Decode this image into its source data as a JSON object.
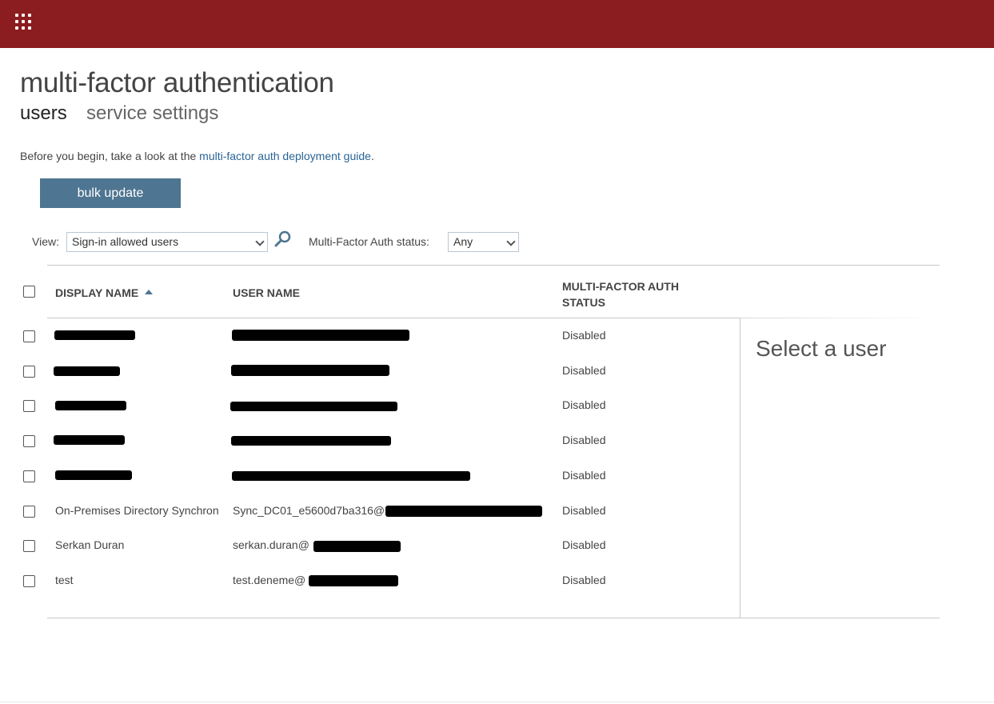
{
  "header": {
    "waffle_icon": "waffle-grid-icon",
    "brand_color": "#8b1c1f"
  },
  "page": {
    "title": "multi-factor authentication",
    "tabs": [
      {
        "label": "users",
        "active": true
      },
      {
        "label": "service settings",
        "active": false
      }
    ],
    "intro_text": "Before you begin, take a look at the ",
    "intro_link": "multi-factor auth deployment guide",
    "intro_suffix": "."
  },
  "toolbar": {
    "bulk_update_label": "bulk update",
    "view_label": "View:",
    "view_value": "Sign-in allowed users",
    "search_icon": "search-icon",
    "mfa_status_label": "Multi-Factor Auth status:",
    "mfa_status_value": "Any"
  },
  "table": {
    "columns": {
      "display_name": "DISPLAY NAME",
      "user_name": "USER NAME",
      "mfa_status_line1": "MULTI-FACTOR AUTH",
      "mfa_status_line2": "STATUS"
    },
    "sort": {
      "column": "display_name",
      "direction": "ascending"
    },
    "rows": [
      {
        "display_name": "",
        "user_name": "",
        "status": "Disabled",
        "name_redacted": true,
        "user_redacted": true
      },
      {
        "display_name": "",
        "user_name": "",
        "status": "Disabled",
        "name_redacted": true,
        "user_redacted": true
      },
      {
        "display_name": "",
        "user_name": "",
        "status": "Disabled",
        "name_redacted": true,
        "user_redacted": true
      },
      {
        "display_name": "",
        "user_name": "",
        "status": "Disabled",
        "name_redacted": true,
        "user_redacted": true
      },
      {
        "display_name": "",
        "user_name": "",
        "status": "Disabled",
        "name_redacted": true,
        "user_redacted": true
      },
      {
        "display_name": "On-Premises Directory Synchronization Service Account",
        "user_name": "Sync_DC01_e5600d7ba316@",
        "status": "Disabled",
        "name_redacted": false,
        "user_redacted": true
      },
      {
        "display_name": "Serkan Duran",
        "user_name": "serkan.duran@",
        "status": "Disabled",
        "name_redacted": false,
        "user_redacted": true
      },
      {
        "display_name": "test",
        "user_name": "test.deneme@",
        "status": "Disabled",
        "name_redacted": false,
        "user_redacted": true
      }
    ]
  },
  "detail_panel": {
    "placeholder": "Select a user"
  }
}
